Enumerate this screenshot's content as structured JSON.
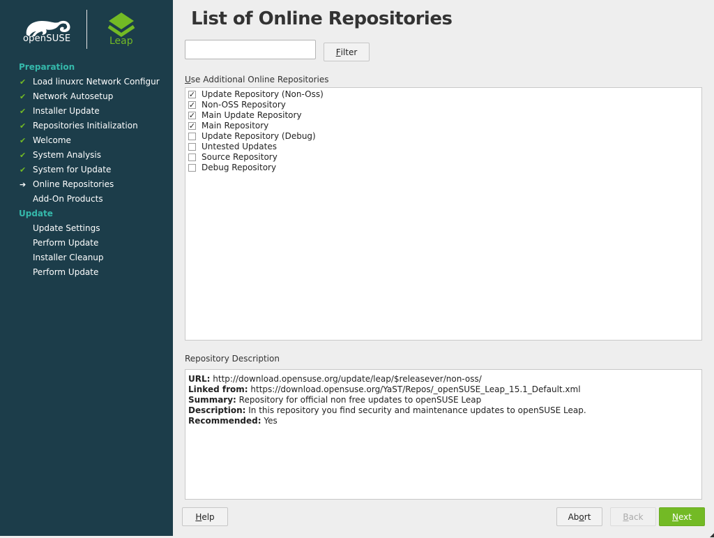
{
  "sidebar": {
    "opensuse_text": "openSUSE",
    "leap_text": "Leap",
    "groups": [
      {
        "title": "Preparation",
        "steps": [
          {
            "label": "Load linuxrc Network Configur",
            "status": "done"
          },
          {
            "label": "Network Autosetup",
            "status": "done"
          },
          {
            "label": "Installer Update",
            "status": "done"
          },
          {
            "label": "Repositories Initialization",
            "status": "done"
          },
          {
            "label": "Welcome",
            "status": "done"
          },
          {
            "label": "System Analysis",
            "status": "done"
          },
          {
            "label": "System for Update",
            "status": "done"
          },
          {
            "label": "Online Repositories",
            "status": "current"
          },
          {
            "label": "Add-On Products",
            "status": "pending"
          }
        ]
      },
      {
        "title": "Update",
        "steps": [
          {
            "label": "Update Settings",
            "status": "pending"
          },
          {
            "label": "Perform Update",
            "status": "pending"
          },
          {
            "label": "Installer Cleanup",
            "status": "pending"
          },
          {
            "label": "Perform Update",
            "status": "pending"
          }
        ]
      }
    ],
    "done_mark": "✔",
    "current_mark": "➔"
  },
  "main": {
    "title": "List of Online Repositories",
    "filter": {
      "value": "",
      "button_label": "Filter",
      "button_mnemonic": "F"
    },
    "repo_list_label": "Use Additional Online Repositories",
    "repositories": [
      {
        "label": "Update Repository (Non-Oss)",
        "checked": true
      },
      {
        "label": "Non-OSS Repository",
        "checked": true
      },
      {
        "label": "Main Update Repository",
        "checked": true
      },
      {
        "label": "Main Repository",
        "checked": true
      },
      {
        "label": "Update Repository (Debug)",
        "checked": false
      },
      {
        "label": "Untested Updates",
        "checked": false
      },
      {
        "label": "Source Repository",
        "checked": false
      },
      {
        "label": "Debug Repository",
        "checked": false
      }
    ],
    "description_label": "Repository Description",
    "description": {
      "url_key": "URL:",
      "url": "http://download.opensuse.org/update/leap/$releasever/non-oss/",
      "linked_key": "Linked from:",
      "linked": "https://download.opensuse.org/YaST/Repos/_openSUSE_Leap_15.1_Default.xml",
      "summary_key": "Summary:",
      "summary": "Repository for official non free updates to openSUSE Leap",
      "desc_key": "Description:",
      "desc": "In this repository you find security and maintenance updates to openSUSE Leap.",
      "recommended_key": "Recommended:",
      "recommended": "Yes"
    }
  },
  "buttons": {
    "help": "Help",
    "abort": "Abort",
    "back": "Back",
    "next": "Next"
  },
  "colors": {
    "sidebar_bg": "#1c3d4a",
    "accent_teal": "#35b9ab",
    "accent_green": "#73ba25"
  }
}
